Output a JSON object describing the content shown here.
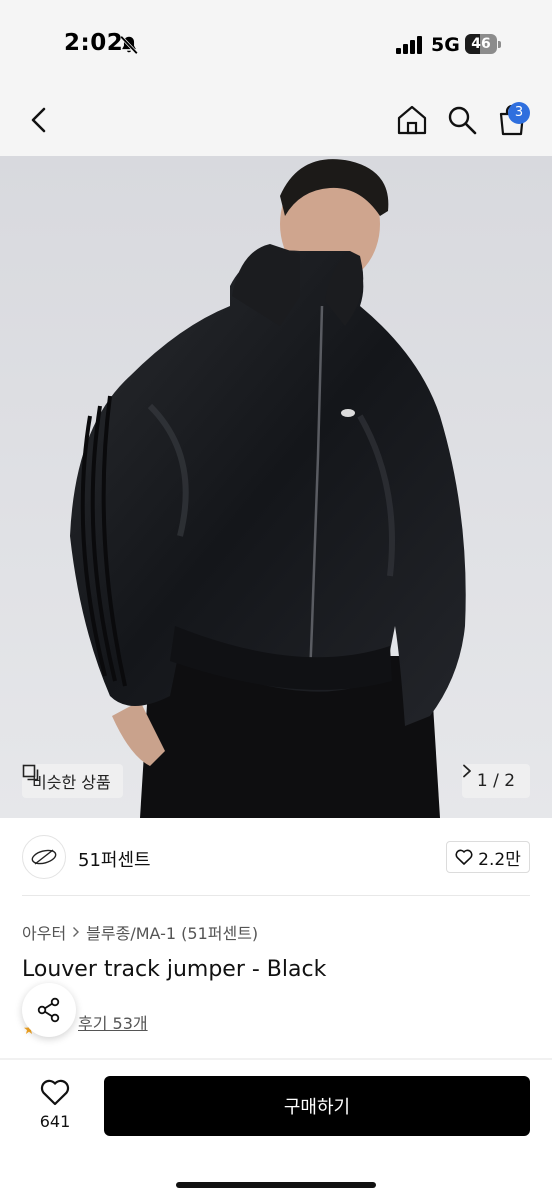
{
  "status_bar": {
    "time": "2:02",
    "network": "5G",
    "battery": "46",
    "battery_fraction": 0.46
  },
  "nav": {
    "cart_count": "3",
    "icons": [
      "back-icon",
      "home-icon",
      "search-icon",
      "cart-icon"
    ]
  },
  "photo": {
    "similar_label": "비슷한 상품",
    "page_counter": "1 / 2"
  },
  "brand": {
    "name": "51퍼센트",
    "likes": "2.2만"
  },
  "product": {
    "breadcrumb": [
      "아우터",
      "블루종/MA-1 (51퍼센트)"
    ],
    "title": "Louver track jumper - Black",
    "reviews": "후기 53개"
  },
  "bottom_bar": {
    "wish_count": "641",
    "buy_label": "구매하기"
  },
  "colors": {
    "badge": "#2f6fde",
    "buy_button": "#000000",
    "background": "#ffffff"
  }
}
